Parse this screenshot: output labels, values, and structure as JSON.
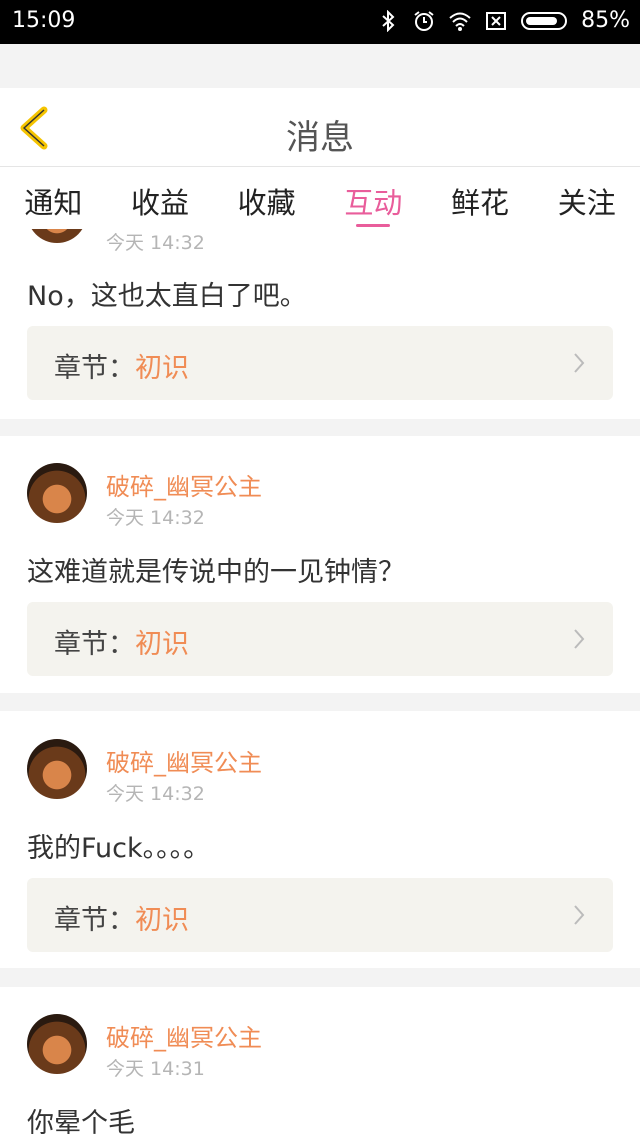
{
  "status_bar": {
    "time": "15:09",
    "battery": "85%"
  },
  "header": {
    "title": "消息"
  },
  "tabs": [
    {
      "label": "通知"
    },
    {
      "label": "收益"
    },
    {
      "label": "收藏"
    },
    {
      "label": "互动"
    },
    {
      "label": "鲜花"
    },
    {
      "label": "关注"
    }
  ],
  "active_tab": "互动",
  "items": [
    {
      "user": "",
      "time": "今天 14:32",
      "message": "No，这也太直白了吧。",
      "chapter_label": "章节：",
      "chapter_name": "初识"
    },
    {
      "user": "破碎_幽冥公主",
      "time": "今天 14:32",
      "message": "这难道就是传说中的一见钟情？",
      "chapter_label": "章节：",
      "chapter_name": "初识"
    },
    {
      "user": "破碎_幽冥公主",
      "time": "今天 14:32",
      "message": "我的Fuck。。。。",
      "chapter_label": "章节：",
      "chapter_name": "初识"
    },
    {
      "user": "破碎_幽冥公主",
      "time": "今天 14:31",
      "message": "你晕个毛",
      "chapter_label": "章节：",
      "chapter_name": "初识"
    }
  ],
  "colors": {
    "accent": "#e95d9b",
    "username": "#f08c55",
    "back_icon": "#f5c400"
  }
}
